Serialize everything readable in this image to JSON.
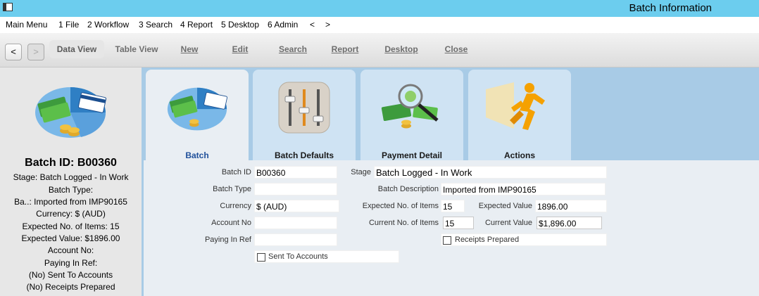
{
  "window": {
    "title": "Batch Information"
  },
  "menu": {
    "items": [
      "Main Menu",
      "1 File",
      "2 Workflow",
      "3 Search",
      "4 Report",
      "5 Desktop",
      "6 Admin",
      "<",
      ">"
    ]
  },
  "toolbar": {
    "back": "<",
    "forward": ">",
    "data_view": "Data View",
    "table_view": "Table View",
    "new": "New",
    "edit": "Edit",
    "search": "Search",
    "report": "Report",
    "desktop": "Desktop",
    "close": "Close"
  },
  "summary": {
    "title": "Batch ID: B00360",
    "lines": [
      "Stage: Batch Logged - In Work",
      "Batch Type:",
      "Ba..: Imported from IMP90165",
      "Currency: $ (AUD)",
      "Expected No. of Items: 15",
      "Expected Value: $1896.00",
      "Account No:",
      "Paying In Ref:",
      "(No) Sent To Accounts",
      "(No) Receipts Prepared"
    ]
  },
  "tabs": [
    {
      "label": "Batch",
      "icon": "money-pie-icon",
      "active": true
    },
    {
      "label": "Batch Defaults",
      "icon": "sliders-icon",
      "active": false
    },
    {
      "label": "Payment Detail",
      "icon": "magnifier-money-icon",
      "active": false
    },
    {
      "label": "Actions",
      "icon": "running-man-icon",
      "active": false
    }
  ],
  "form": {
    "batch_id": {
      "label": "Batch ID",
      "value": "B00360"
    },
    "batch_type": {
      "label": "Batch Type",
      "value": ""
    },
    "currency": {
      "label": "Currency",
      "value": "$ (AUD)"
    },
    "account_no": {
      "label": "Account No",
      "value": ""
    },
    "paying_in_ref": {
      "label": "Paying In Ref",
      "value": ""
    },
    "sent_to_accounts": {
      "label": "Sent To Accounts",
      "checked": false
    },
    "stage": {
      "label": "Stage",
      "value": "Batch Logged - In Work"
    },
    "batch_description": {
      "label": "Batch Description",
      "value": "Imported from IMP90165"
    },
    "expected_items": {
      "label": "Expected No. of Items",
      "value": "15"
    },
    "expected_value": {
      "label": "Expected Value",
      "value": "1896.00"
    },
    "current_items": {
      "label": "Current No. of Items",
      "value": "15"
    },
    "current_value": {
      "label": "Current Value",
      "value": "$1,896.00"
    },
    "receipts_prepared": {
      "label": "Receipts Prepared",
      "checked": false
    }
  },
  "colors": {
    "title_bar": "#6ccdee",
    "tab_strip": "#a8cbe6",
    "form_background": "#e9eef3",
    "active_tab_label": "#1f4f9a"
  }
}
